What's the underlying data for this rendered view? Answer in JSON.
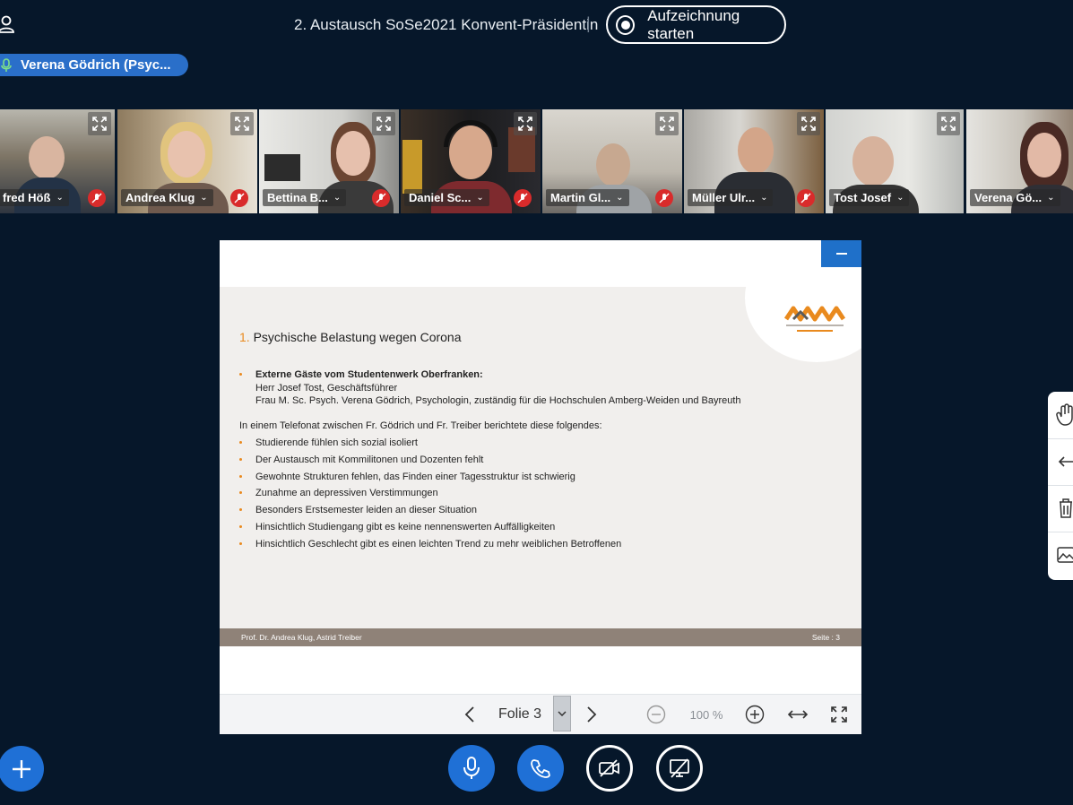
{
  "header": {
    "meeting_title": "2. Austausch SoSe2021 Konvent-Präsidentin",
    "separator": "|",
    "record_label": "Aufzeichnung starten",
    "talking_indicator": "Verena Gödrich (Psyc..."
  },
  "participants": [
    {
      "name": "fred Höß",
      "muted": true
    },
    {
      "name": "Andrea Klug",
      "muted": true
    },
    {
      "name": "Bettina B...",
      "muted": true
    },
    {
      "name": "Daniel Sc...",
      "muted": true
    },
    {
      "name": "Martin Gl...",
      "muted": true
    },
    {
      "name": "Müller Ulr...",
      "muted": true
    },
    {
      "name": "Tost Josef",
      "muted": false
    },
    {
      "name": "Verena Gö...",
      "muted": false,
      "active": true
    }
  ],
  "slide": {
    "heading_number": "1.",
    "heading": "Psychische Belastung wegen Corona",
    "guests_title": "Externe Gäste vom Studentenwerk Oberfranken:",
    "guest_1": "Herr Josef Tost, Geschäftsführer",
    "guest_2": "Frau M. Sc. Psych. Verena Gödrich, Psychologin, zuständig für die Hochschulen Amberg-Weiden und Bayreuth",
    "intro": "In einem Telefonat zwischen Fr. Gödrich und Fr. Treiber berichtete diese folgendes:",
    "bullets": [
      "Studierende fühlen sich sozial isoliert",
      "Der Austausch mit Kommilitonen und Dozenten fehlt",
      "Gewohnte Strukturen fehlen, das Finden einer Tagesstruktur ist schwierig",
      "Zunahme an depressiven Verstimmungen",
      "Besonders Erstsemester leiden an dieser Situation",
      "Hinsichtlich Studiengang gibt es keine nennenswerten Auffälligkeiten",
      "Hinsichtlich Geschlecht gibt es einen leichten Trend zu mehr weiblichen Betroffenen"
    ],
    "footer_left": "Prof. Dr. Andrea Klug, Astrid Treiber",
    "footer_right": "Seite : 3",
    "accent_color": "#e98a1e"
  },
  "presentation_toolbar": {
    "slide_label": "Folie 3",
    "zoom": "100 %"
  },
  "colors": {
    "background": "#06172a",
    "primary": "#1f70d6",
    "muted_badge": "#d92b2b"
  }
}
